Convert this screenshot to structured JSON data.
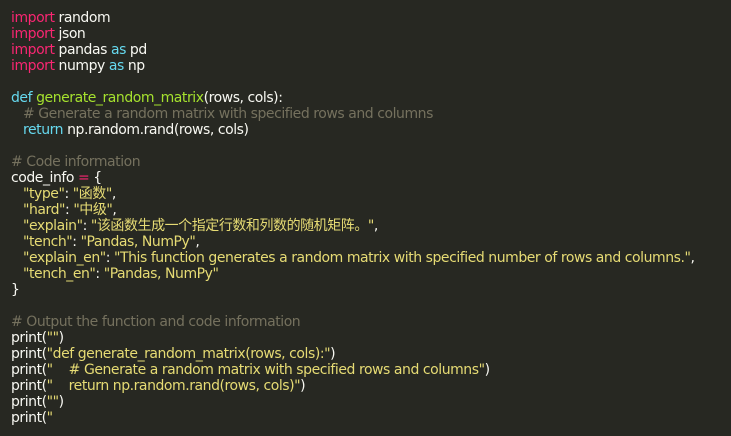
{
  "colors": {
    "background": "#272822",
    "plain": "#f8f8f2",
    "keyword": "#f92672",
    "builtin": "#66d9ef",
    "function": "#a6e22e",
    "comment": "#75715e",
    "string": "#e6db74"
  },
  "code": {
    "imports": [
      {
        "kw": "import",
        "name": " random",
        "as_kw": "",
        "alias": ""
      },
      {
        "kw": "import",
        "name": " json",
        "as_kw": "",
        "alias": ""
      },
      {
        "kw": "import",
        "name": " pandas ",
        "as_kw": "as",
        "alias": " pd"
      },
      {
        "kw": "import",
        "name": " numpy ",
        "as_kw": "as",
        "alias": " np"
      }
    ],
    "def_kw": "def",
    "func_name": " generate_random_matrix",
    "func_params": "(rows, cols):",
    "docstring_comment": "# Generate a random matrix with specified rows and columns",
    "return_kw": "return",
    "return_expr": " np.random.rand(rows, cols)",
    "info_comment": "# Code information",
    "dict_var": "code_info",
    "dict_assign": " = ",
    "dict_open": "{",
    "entries": [
      {
        "key": "\"type\"",
        "sep": ": ",
        "value": "\"函数\"",
        "comma": ","
      },
      {
        "key": "\"hard\"",
        "sep": ": ",
        "value": "\"中级\"",
        "comma": ","
      },
      {
        "key": "\"explain\"",
        "sep": ": ",
        "value": "\"该函数生成一个指定行数和列数的随机矩阵。\"",
        "comma": ","
      },
      {
        "key": "\"tench\"",
        "sep": ": ",
        "value": "\"Pandas, NumPy\"",
        "comma": ","
      },
      {
        "key": "\"explain_en\"",
        "sep": ": ",
        "value": "\"This function generates a random matrix with specified number of rows and columns.\"",
        "comma": ","
      },
      {
        "key": "\"tench_en\"",
        "sep": ": ",
        "value": "\"Pandas, NumPy\"",
        "comma": ""
      }
    ],
    "dict_close": "}",
    "output_comment": "# Output the function and code information",
    "prints": [
      {
        "fn": "print(",
        "arg": "\"\"",
        "close": ")"
      },
      {
        "fn": "print(",
        "arg": "\"def generate_random_matrix(rows, cols):\"",
        "close": ")"
      },
      {
        "fn": "print(",
        "arg": "\"    # Generate a random matrix with specified rows and columns\"",
        "close": ")"
      },
      {
        "fn": "print(",
        "arg": "\"    return np.random.rand(rows, cols)\"",
        "close": ")"
      },
      {
        "fn": "print(",
        "arg": "\"\"",
        "close": ")"
      },
      {
        "fn": "print(",
        "arg": "\"",
        "close": ""
      }
    ]
  }
}
